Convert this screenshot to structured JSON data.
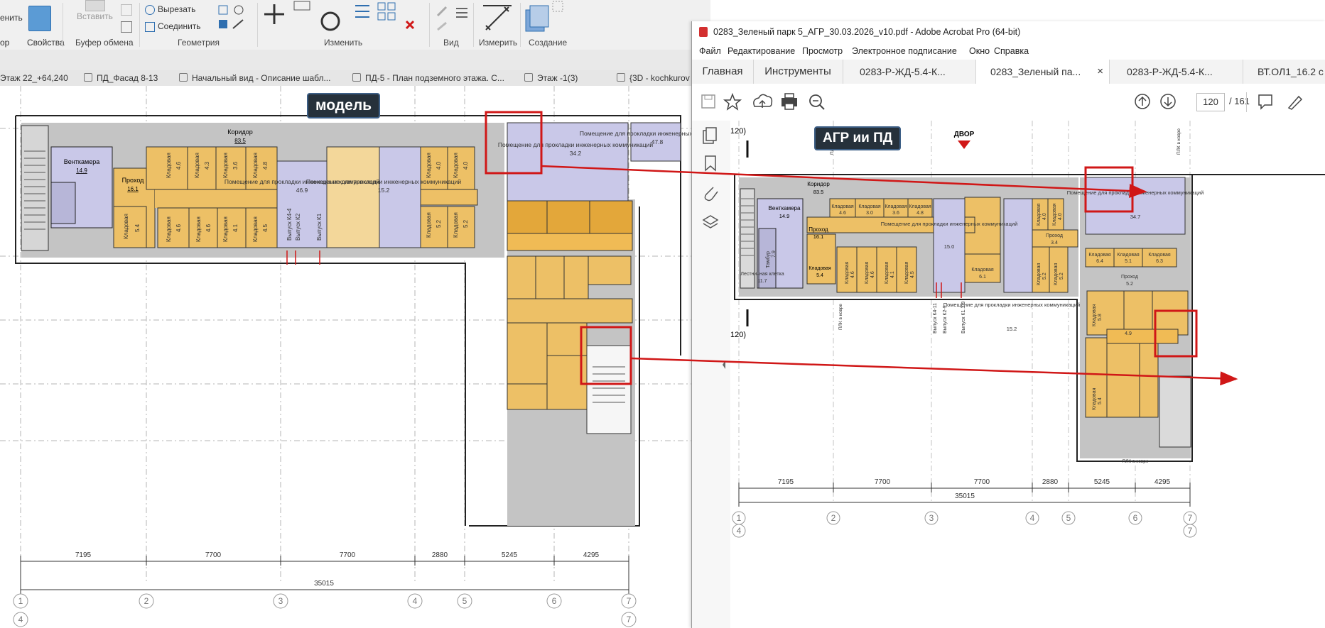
{
  "ribbon": {
    "left_partial": "енить",
    "properties_label": "Свойства",
    "modify_partial": "ор",
    "paste_label": "Вставить",
    "clipboard_caption": "Буфер обмена",
    "cut_label": "Вырезать",
    "join_label": "Соединить",
    "geometry_caption": "Геометрия",
    "modify_caption": "Изменить",
    "view_caption": "Вид",
    "measure_caption": "Измерить",
    "create_caption": "Создание"
  },
  "view_tabs": [
    "Этаж 22_+64,240",
    "ПД_Фасад 8-13",
    "Начальный вид - Описание шабл...",
    "ПД-5 - План подземного этажа. С...",
    "Этаж -1(3)",
    "{3D - kochkurov"
  ],
  "model": {
    "tag": "модель",
    "rooms": [
      {
        "name": "Коридор",
        "area": "83.5"
      },
      {
        "name": "Венткамера",
        "area": "14.9"
      },
      {
        "name": "Проход",
        "area": "16.1"
      },
      {
        "name": "Кладовая",
        "area": "5.4"
      },
      {
        "name": "Кладовая",
        "area": "4.6"
      },
      {
        "name": "Кладовая",
        "area": "4.3"
      },
      {
        "name": "Кладовая",
        "area": "3.6"
      },
      {
        "name": "Кладовая",
        "area": "4.8"
      },
      {
        "name": "Кладовая",
        "area": "4.6"
      },
      {
        "name": "Кладовая",
        "area": "4.6"
      },
      {
        "name": "Кладовая",
        "area": "4.1"
      },
      {
        "name": "Кладовая",
        "area": "4.5"
      },
      {
        "name": "Кладовая",
        "area": "4.0"
      },
      {
        "name": "Кладовая",
        "area": "4.0"
      },
      {
        "name": "Кладовая",
        "area": "5.2"
      },
      {
        "name": "Кладовая",
        "area": "5.2"
      }
    ],
    "utility_rooms": [
      {
        "name": "Помещение для прокладки инженерных коммуникаций",
        "area": "46.9"
      },
      {
        "name": "Помещение для прокладки инженерных коммуникаций",
        "area": "15.2"
      },
      {
        "name": "Помещение для прокладки инженерных коммуникаций",
        "area": "34.2"
      },
      {
        "name": "Помещение для прокладки инженерных коммуникаций",
        "area": "47.8"
      }
    ],
    "outlets": [
      "Выпуск К4-4",
      "Выпуск К2",
      "Выпуск К1"
    ],
    "dims": [
      "7195",
      "7700",
      "7700",
      "2880",
      "5245",
      "4295"
    ],
    "total_dim": "35015",
    "axes": [
      "1",
      "2",
      "3",
      "4",
      "5",
      "6",
      "7"
    ],
    "axes_sub": [
      "4",
      "7"
    ]
  },
  "acrobat": {
    "title": "0283_Зеленый парк 5_АГР_30.03.2026_v10.pdf - Adobe Acrobat Pro (64-bit)",
    "menu": [
      "Файл",
      "Редактирование",
      "Просмотр",
      "Электронное подписание",
      "Окно",
      "Справка"
    ],
    "tabs": [
      "Главная",
      "Инструменты",
      "0283-Р-ЖД-5.4-К...",
      "0283_Зеленый па...",
      "0283-Р-ЖД-5.4-К...",
      "ВТ.ОЛ1_16.2 с"
    ],
    "page_current": "120",
    "page_total": "/ 161",
    "pdf": {
      "tag": "АГР ии ПД",
      "dvor_label": "ДВОР",
      "partial_120a": "120)",
      "partial_120b": "120)",
      "pk_labels": [
        "ПЛК в коврe",
        "ПЛК в коврe",
        "ПЛК в коврe",
        "ПЛК в коврe"
      ],
      "rooms": [
        {
          "name": "Коридор",
          "area": "83.5"
        },
        {
          "name": "Венткамера",
          "area": "14.9"
        },
        {
          "name": "Проход",
          "area": "16.1"
        },
        {
          "name": "Кладовая",
          "area": "5.4"
        },
        {
          "name": "Кладовая",
          "area": "4.6"
        },
        {
          "name": "Кладовая",
          "area": "3.0"
        },
        {
          "name": "Кладовая",
          "area": "3.6"
        },
        {
          "name": "Кладовая",
          "area": "4.8"
        },
        {
          "name": "Кладовая",
          "area": "4.6"
        },
        {
          "name": "Кладовая",
          "area": "4.6"
        },
        {
          "name": "Кладовая",
          "area": "4.1"
        },
        {
          "name": "Кладовая",
          "area": "4.5"
        },
        {
          "name": "Кладовая",
          "area": "6.1"
        },
        {
          "name": "Кладовая",
          "area": "4.0"
        },
        {
          "name": "Кладовая",
          "area": "4.0"
        },
        {
          "name": "Проход",
          "area": "3.4"
        },
        {
          "name": "Кладовая",
          "area": "5.2"
        },
        {
          "name": "Кладовая",
          "area": "5.2"
        },
        {
          "name": "Кладовая",
          "area": "6.4"
        },
        {
          "name": "Кладовая",
          "area": "5.1"
        },
        {
          "name": "Кладовая",
          "area": "6.3"
        },
        {
          "name": "Проход",
          "area": "5.2"
        },
        {
          "name": "Проход",
          "area": "4.9"
        },
        {
          "name": "Кладовая",
          "area": "5.8"
        },
        {
          "name": "Кладовая",
          "area": "5.4"
        }
      ],
      "stair_label": "Лестничная клетка",
      "stair_area": "11.7",
      "tamb_label": "Тамбур",
      "tamb_area": "7.9",
      "utility_rooms": [
        {
          "name": "Помещение для прокладки инженерных коммуникаций",
          "area": "15.0"
        },
        {
          "name": "Помещение для прокладки инженерных коммуникаций",
          "area": "15.2"
        },
        {
          "name": "Помещение для прокладки инженерных коммуникаций",
          "area": "34.7"
        }
      ],
      "outlets": [
        "Выпуск К4-11",
        "Выпуск К2-9",
        "Выпуск К1.1-9"
      ],
      "dims": [
        "7195",
        "7700",
        "7700",
        "2880",
        "5245",
        "4295"
      ],
      "total_dim": "35015",
      "axes": [
        "1",
        "2",
        "3",
        "4",
        "5",
        "6",
        "7"
      ],
      "axes_sub": [
        "4",
        "7"
      ]
    }
  },
  "colors": {
    "storage": "#edc066",
    "storage_dark": "#e3a73a",
    "utility": "#c9c8e8",
    "corridor": "#c4c4c4",
    "highlight": "#d01717",
    "tag_bg": "#26313b"
  }
}
